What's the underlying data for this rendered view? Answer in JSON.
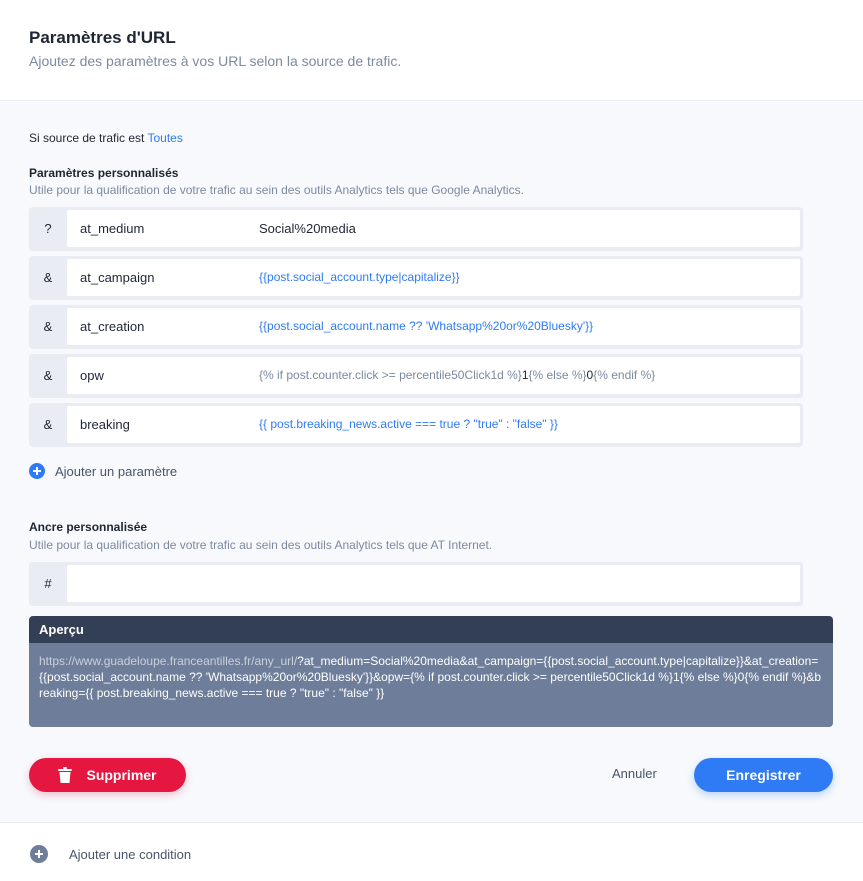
{
  "header": {
    "title": "Paramètres d'URL",
    "subtitle": "Ajoutez des paramètres à vos URL selon la source de trafic."
  },
  "source": {
    "prefix": "Si source de trafic est ",
    "value": "Toutes"
  },
  "custom_params": {
    "title": "Paramètres personnalisés",
    "description": "Utile pour la qualification de votre trafic au sein des outils Analytics tels que Google Analytics.",
    "rows": [
      {
        "sep": "?",
        "key": "at_medium",
        "value": "Social%20media"
      },
      {
        "sep": "&",
        "key": "at_campaign",
        "value": "{{post.social_account.type|capitalize}}"
      },
      {
        "sep": "&",
        "key": "at_creation",
        "value": "{{post.social_account.name ?? 'Whatsapp%20or%20Bluesky'}}"
      },
      {
        "sep": "&",
        "key": "opw",
        "value_parts": [
          "{% if post.counter.click >= percentile50Click1d %}",
          "1",
          "{% else %}",
          "0",
          "{% endif %}"
        ]
      },
      {
        "sep": "&",
        "key": "breaking",
        "value": "{{ post.breaking_news.active === true ? \"true\" : \"false\" }}"
      }
    ],
    "add_label": "Ajouter un paramètre"
  },
  "anchor": {
    "title": "Ancre personnalisée",
    "description": "Utile pour la qualification de votre trafic au sein des outils Analytics tels que AT Internet.",
    "sep": "#",
    "key": "",
    "value": ""
  },
  "preview": {
    "title": "Aperçu",
    "base_url": "https://www.guadeloupe.franceantilles.fr/any_url/",
    "query": "?at_medium=Social%20media&at_campaign={{post.social_account.type|capitalize}}&at_creation={{post.social_account.name ?? 'Whatsapp%20or%20Bluesky'}}&opw={% if post.counter.click >= percentile50Click1d %}1{% else %}0{% endif %}&breaking={{ post.breaking_news.active === true ? \"true\" : \"false\" }}"
  },
  "actions": {
    "delete_label": "Supprimer",
    "cancel_label": "Annuler",
    "save_label": "Enregistrer"
  },
  "footer": {
    "add_condition_label": "Ajouter une condition"
  },
  "icons": {
    "delete": "trash-icon",
    "add": "plus-circle-icon"
  },
  "colors": {
    "accent": "#2f7bf5",
    "danger": "#e5163f",
    "preview_header": "#333f55",
    "preview_body": "#6e7d99"
  }
}
